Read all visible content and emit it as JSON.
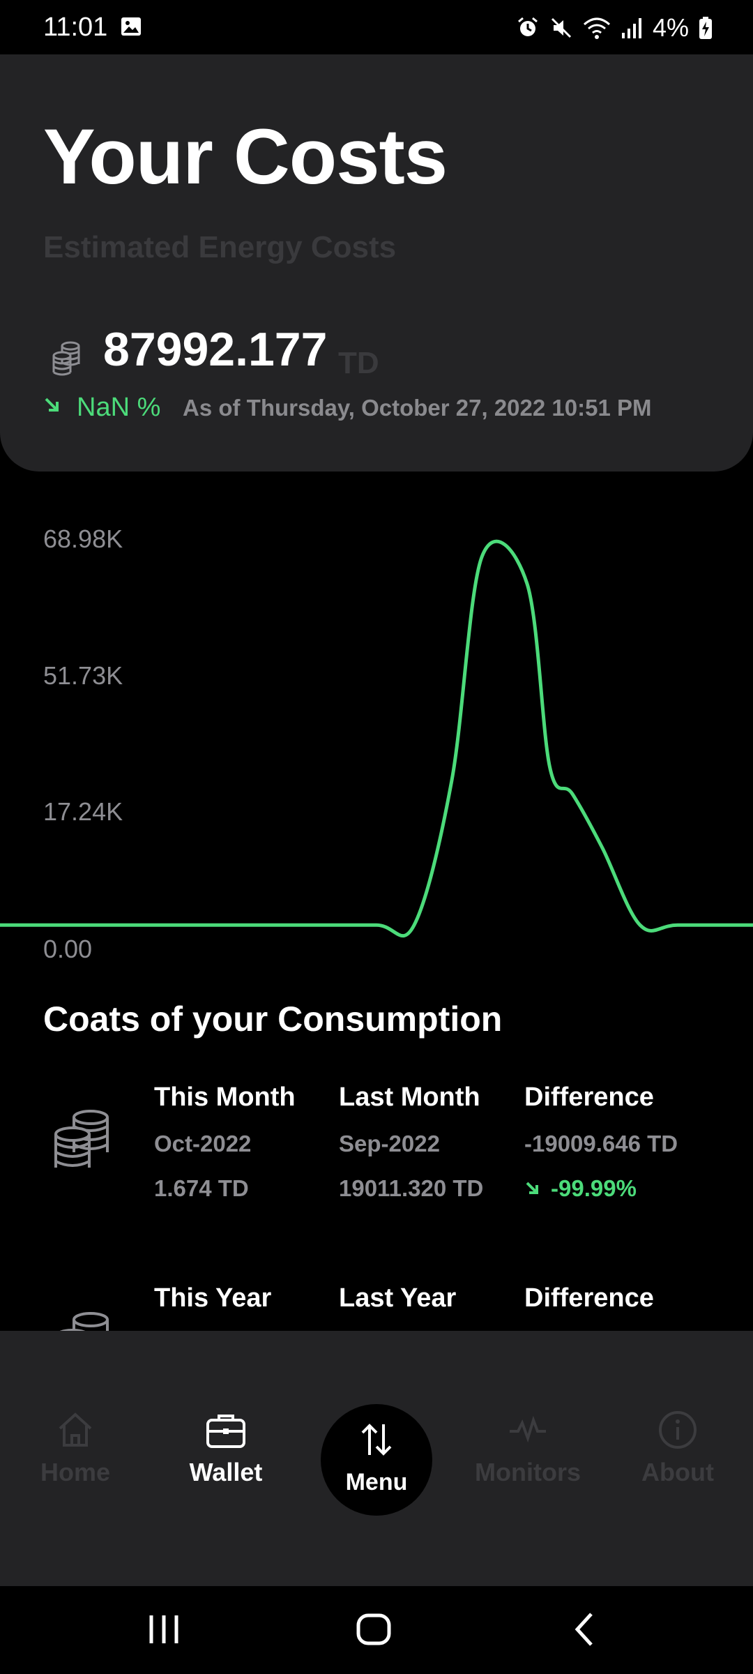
{
  "status_bar": {
    "time": "11:01",
    "battery": "4%"
  },
  "header": {
    "title": "Your Costs",
    "subtitle": "Estimated Energy Costs",
    "total_value": "87992.177",
    "total_unit": "TD",
    "change_percent": "NaN %",
    "as_of": "As of Thursday, October 27, 2022 10:51 PM"
  },
  "chart_data": {
    "type": "line",
    "y_ticks": [
      "68.98K",
      "51.73K",
      "17.24K",
      "0.00"
    ],
    "ylim": [
      0,
      68980
    ],
    "grid": false,
    "series": [
      {
        "color": "#4cdb7a",
        "x": [
          0,
          0.1,
          0.2,
          0.3,
          0.4,
          0.5,
          0.55,
          0.6,
          0.64,
          0.7,
          0.73,
          0.76,
          0.8,
          0.85,
          0.9,
          1.0
        ],
        "values": [
          8620,
          8620,
          8620,
          8620,
          8620,
          8620,
          8620,
          30000,
          63000,
          59000,
          32000,
          28000,
          20000,
          8620,
          8620,
          8620
        ]
      }
    ]
  },
  "consumption": {
    "title": "Coats of your Consumption",
    "monthly": {
      "this_label": "This Month",
      "this_period": "Oct-2022",
      "this_value": "1.674 TD",
      "last_label": "Last Month",
      "last_period": "Sep-2022",
      "last_value": "19011.320 TD",
      "diff_label": "Difference",
      "diff_value": "-19009.646 TD",
      "diff_percent": "-99.99%"
    },
    "yearly": {
      "this_label": "This Year",
      "last_label": "Last Year",
      "diff_label": "Difference"
    }
  },
  "bottom_nav": {
    "items": [
      {
        "label": "Home",
        "icon": "home-icon"
      },
      {
        "label": "Wallet",
        "icon": "wallet-icon"
      },
      {
        "label": "Menu",
        "icon": "swap-vertical-icon"
      },
      {
        "label": "Monitors",
        "icon": "pulse-icon"
      },
      {
        "label": "About",
        "icon": "info-icon"
      }
    ]
  },
  "colors": {
    "accent": "#4cdb7a",
    "card": "#232325",
    "background": "#000000"
  }
}
